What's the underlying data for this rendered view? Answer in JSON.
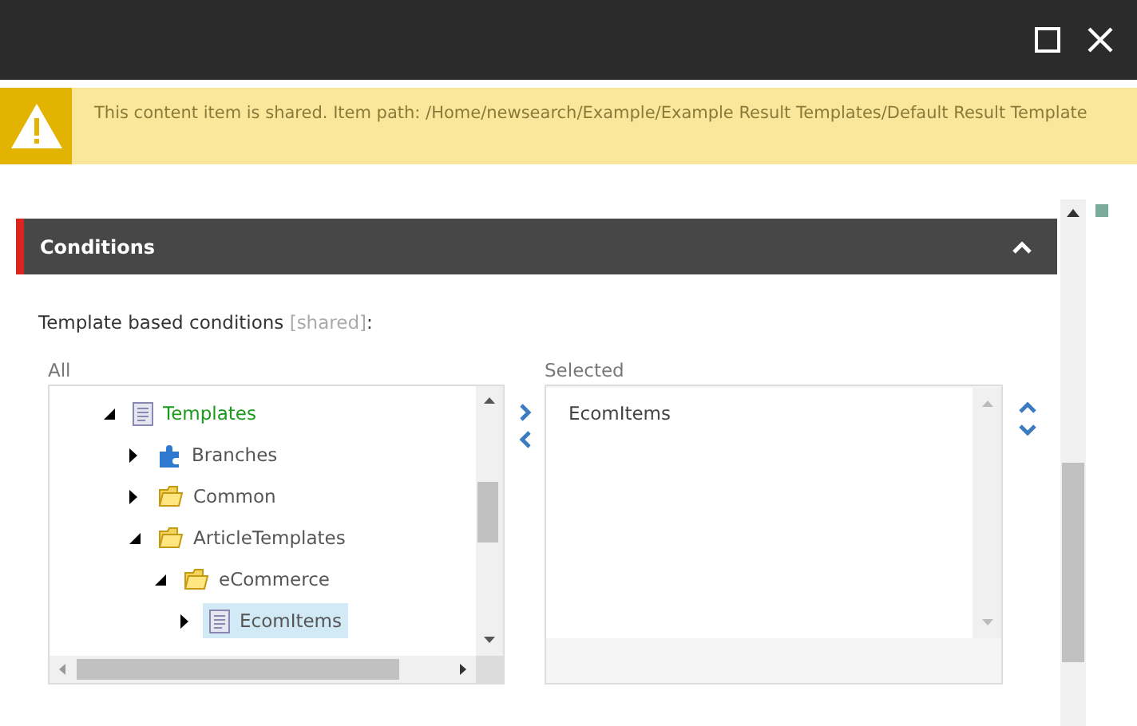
{
  "notice": {
    "text": "This content item is shared. Item path: /Home/newsearch/Example/Example Result Templates/Default Result Template"
  },
  "section": {
    "title": "Conditions",
    "expanded": true
  },
  "field": {
    "label": "Template based conditions ",
    "note": "[shared]",
    "suffix": ":"
  },
  "all": {
    "label": "All",
    "tree": [
      {
        "label": "Templates",
        "kind": "template",
        "expanded": true,
        "selected": false,
        "highlighted": true,
        "children": [
          {
            "label": "Branches",
            "kind": "branch",
            "expanded": false,
            "selected": false,
            "highlighted": false
          },
          {
            "label": "Common",
            "kind": "folder",
            "expanded": false,
            "selected": false,
            "highlighted": false
          },
          {
            "label": "ArticleTemplates",
            "kind": "folder",
            "expanded": true,
            "selected": false,
            "highlighted": false,
            "children": [
              {
                "label": "eCommerce",
                "kind": "folder",
                "expanded": true,
                "selected": false,
                "highlighted": false,
                "children": [
                  {
                    "label": "EcomItems",
                    "kind": "template",
                    "expanded": false,
                    "selected": true,
                    "highlighted": false
                  }
                ]
              }
            ]
          }
        ]
      }
    ]
  },
  "selected": {
    "label": "Selected",
    "items": [
      "EcomItems"
    ]
  }
}
